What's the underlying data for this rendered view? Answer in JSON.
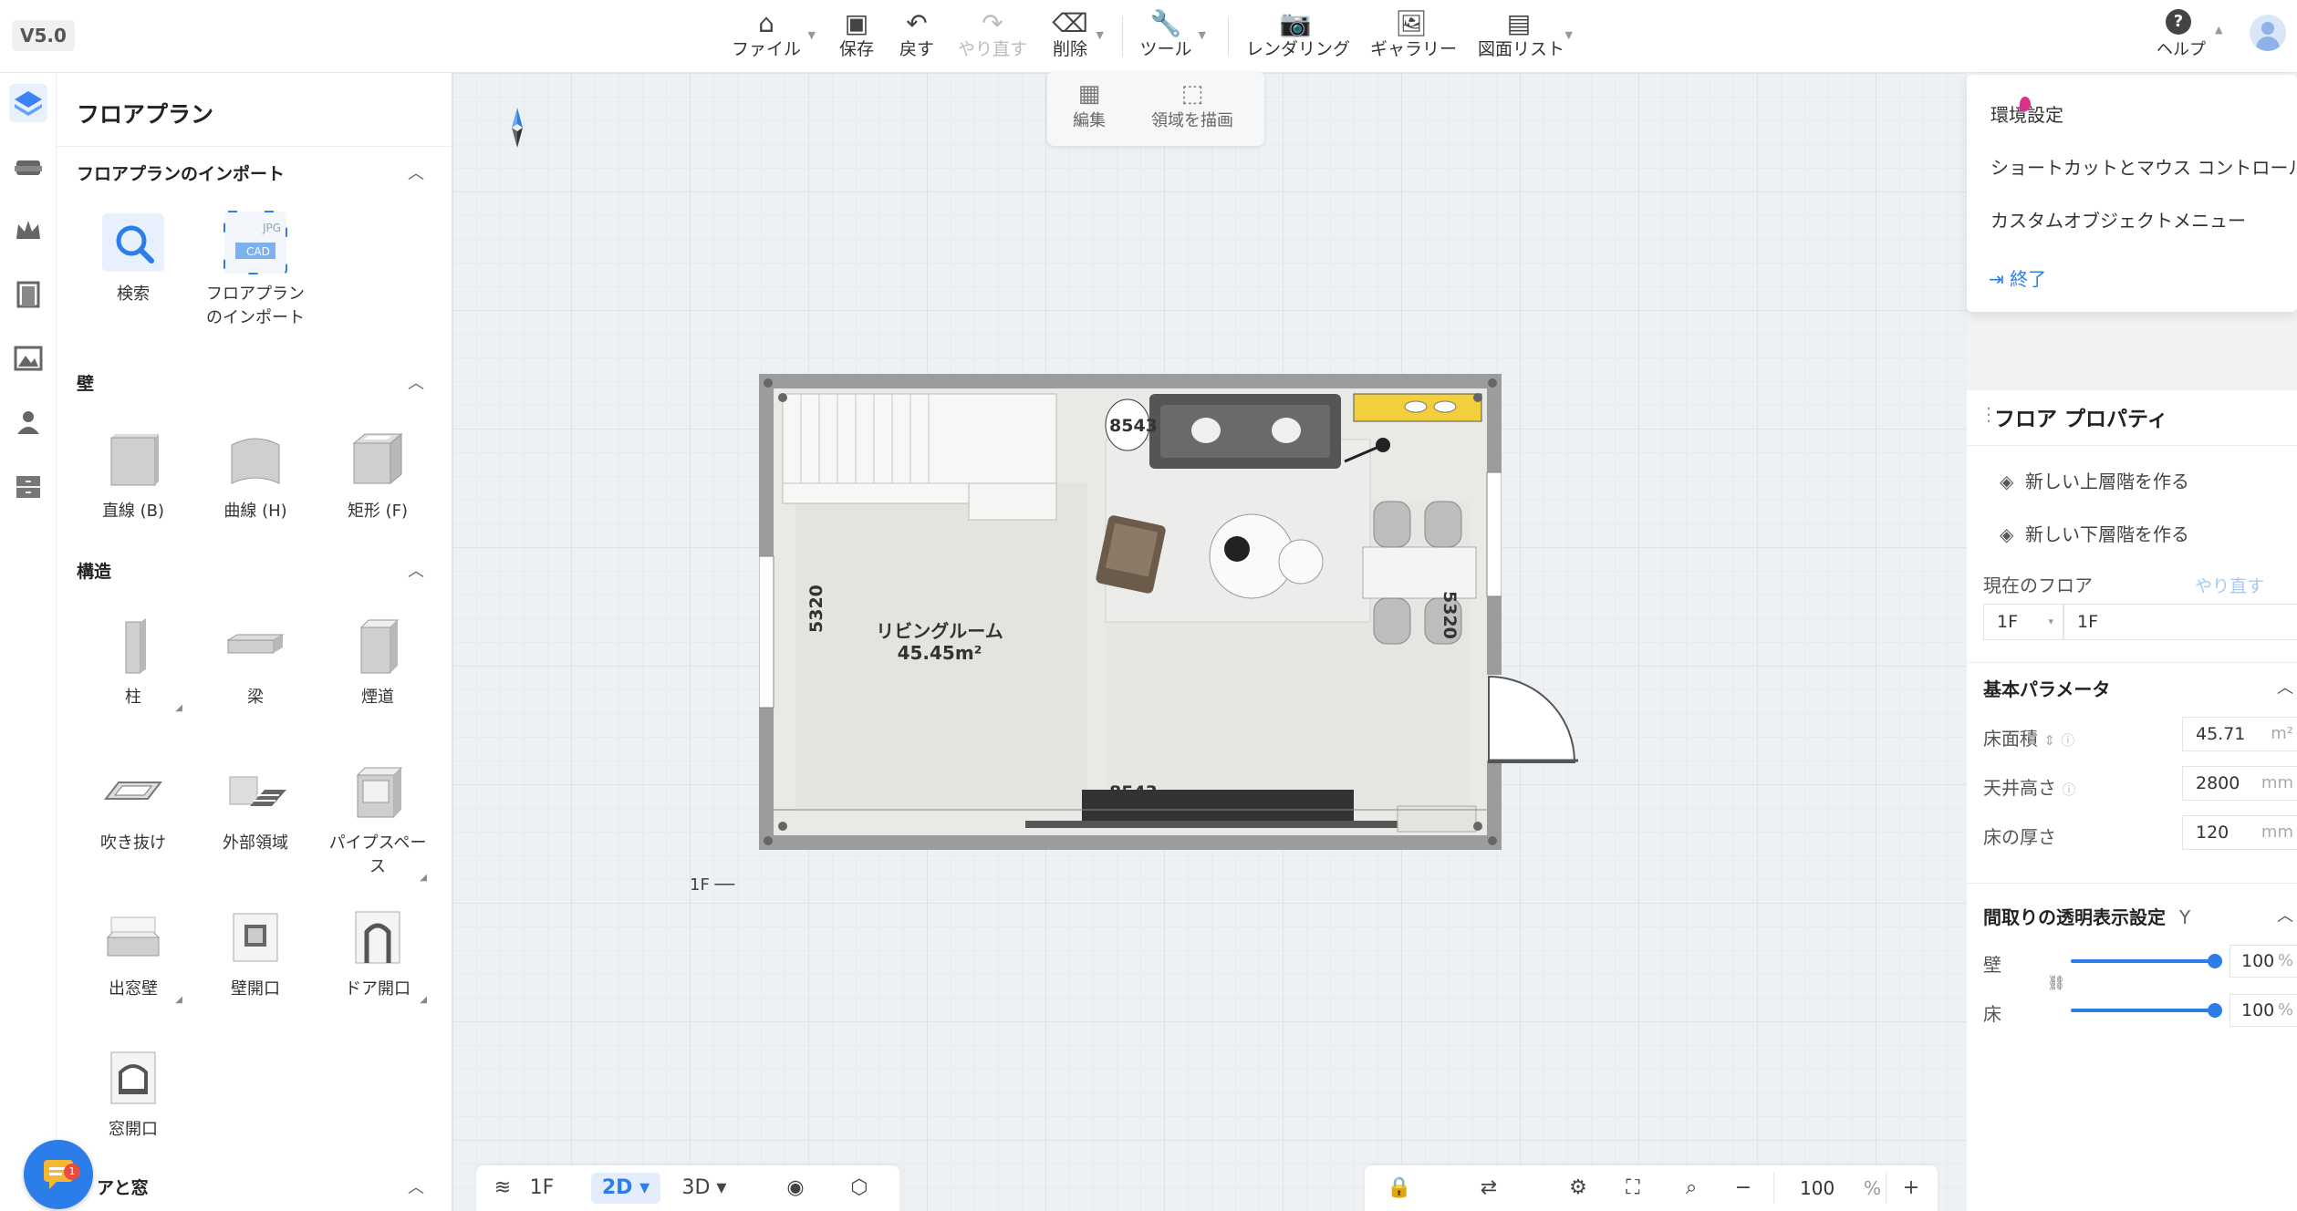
{
  "app": {
    "version": "V5.0"
  },
  "toolbar": {
    "file": "ファイル",
    "save": "保存",
    "undo": "戻す",
    "redo": "やり直す",
    "delete": "削除",
    "tools": "ツール",
    "rendering": "レンダリング",
    "gallery": "ギャラリー",
    "drawing_list": "図面リスト",
    "help": "ヘルプ"
  },
  "subtoolbar": {
    "edit": "編集",
    "draw_area": "領域を描画"
  },
  "left_panel": {
    "title": "フロアプラン",
    "sections": {
      "import": "フロアプランのインポート",
      "wall": "壁",
      "structure": "構造",
      "doors_windows": "アと窓"
    },
    "import_tools": {
      "search": "検索",
      "import_line1": "フロアプラン",
      "import_line2": "のインポート"
    },
    "wall_tools": {
      "straight": "直線 (B)",
      "curve": "曲線 (H)",
      "rect": "矩形 (F)"
    },
    "structure_tools": {
      "column": "柱",
      "beam": "梁",
      "flue": "煙道",
      "void": "吹き抜け",
      "exterior": "外部領域",
      "pipe_line1": "パイプスペー",
      "pipe_line2": "ス",
      "bay_window": "出窓壁",
      "wall_opening": "壁開口",
      "door_opening": "ドア開口",
      "window_opening": "窓開口"
    }
  },
  "canvas": {
    "room_name": "リビングルーム",
    "room_area": "45.45m²",
    "dim_top": "8543",
    "dim_bottom": "8543",
    "dim_left": "5320",
    "dim_right": "5320",
    "floor_marker": "1F"
  },
  "bottom_bar": {
    "floor": "1F",
    "view_2d": "2D",
    "view_3d": "3D",
    "zoom_value": "100",
    "zoom_unit": "%"
  },
  "help_menu": {
    "settings": "環境設定",
    "shortcuts": "ショートカットとマウス コントロール",
    "custom_menu": "カスタムオブジェクトメニュー",
    "exit": "終了"
  },
  "properties": {
    "title": "フロア プロパティ",
    "new_upper": "新しい上層階を作る",
    "new_lower": "新しい下層階を作る",
    "current_floor": "現在のフロア",
    "redo_link": "やり直す",
    "floor_select": "1F",
    "floor_name": "1F",
    "basic_params": "基本パラメータ",
    "floor_area_label": "床面積",
    "floor_area_value": "45.71",
    "floor_area_unit": "m²",
    "ceiling_label": "天井高さ",
    "ceiling_value": "2800",
    "ceiling_unit": "mm",
    "thickness_label": "床の厚さ",
    "thickness_value": "120",
    "thickness_unit": "mm",
    "transparency": "間取りの透明表示設定",
    "transparency_key": "Y",
    "wall_label": "壁",
    "wall_value": "100",
    "floor_label": "床",
    "floor_value": "100",
    "percent": "%"
  },
  "chat": {
    "badge": "1"
  },
  "colors": {
    "accent": "#2b7de9",
    "accent_bg": "#e3edfb"
  }
}
